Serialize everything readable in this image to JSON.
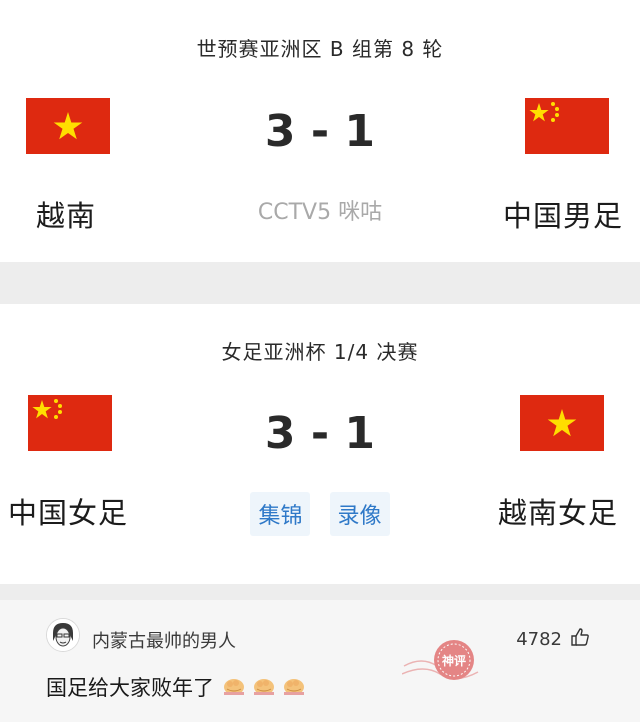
{
  "match1": {
    "event": "世预赛亚洲区 B 组第 8 轮",
    "home_team": "越南",
    "away_team": "中国男足",
    "score": "3 - 1",
    "channels": "CCTV5 咪咕",
    "home_flag": "vietnam-flag",
    "away_flag": "china-flag"
  },
  "match2": {
    "event": "女足亚洲杯 1/4 决赛",
    "home_team": "中国女足",
    "away_team": "越南女足",
    "score": "3 - 1",
    "tags": [
      "集锦",
      "录像"
    ],
    "home_flag": "china-flag",
    "away_flag": "vietnam-flag"
  },
  "comment": {
    "username": "内蒙古最帅的男人",
    "likes": "4782",
    "text": "国足给大家败年了",
    "emoji": "fist-salute-emoji",
    "stamp_text": "神评"
  },
  "colors": {
    "flag_red": "#de2910",
    "star_yellow": "#ffde00",
    "tag_blue": "#2f79c8",
    "stamp_red": "#e06a6a"
  }
}
